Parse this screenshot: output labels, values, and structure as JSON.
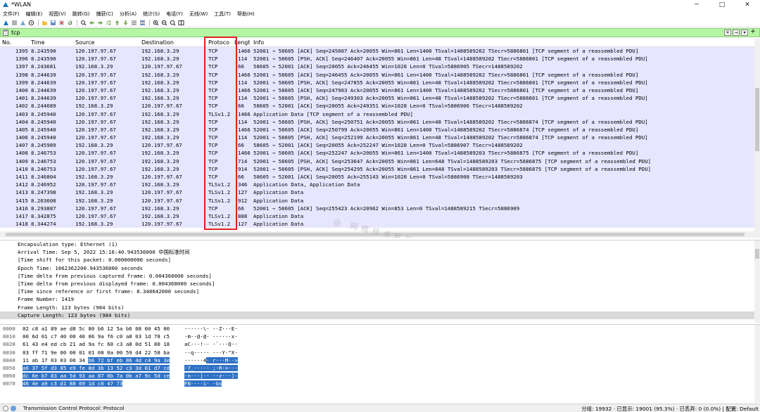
{
  "window": {
    "title": "*WLAN",
    "minimize": "─",
    "maximize": "□",
    "close": "✕"
  },
  "menu": [
    "文件(F)",
    "编辑(E)",
    "视图(V)",
    "跳转(G)",
    "捕获(C)",
    "分析(A)",
    "统计(S)",
    "电话(Y)",
    "无线(W)",
    "工具(T)",
    "帮助(H)"
  ],
  "filter": {
    "value": "tcp"
  },
  "columns": {
    "no": "No.",
    "time": "Time",
    "source": "Source",
    "destination": "Destination",
    "protocol": "Protoco",
    "length": "Lengt",
    "info": "Info"
  },
  "packets": [
    {
      "no": "1395",
      "time": "8.243590",
      "src": "120.197.97.67",
      "dst": "192.168.3.29",
      "proto": "TCP",
      "len": "1466",
      "info": "52001 → 58605 [ACK] Seq=245007 Ack=20055 Win=861 Len=1400 TSval=1488589202 TSecr=5886801 [TCP segment of a reassembled PDU]"
    },
    {
      "no": "1396",
      "time": "8.243590",
      "src": "120.197.97.67",
      "dst": "192.168.3.29",
      "proto": "TCP",
      "len": "114",
      "info": "52001 → 58605 [PSH, ACK] Seq=246407 Ack=20055 Win=861 Len=48 TSval=1488589202 TSecr=5886801 [TCP segment of a reassembled PDU]"
    },
    {
      "no": "1397",
      "time": "8.243681",
      "src": "192.168.3.29",
      "dst": "120.197.97.67",
      "proto": "TCP",
      "len": "66",
      "info": "58605 → 52001 [ACK] Seq=20055 Ack=246455 Win=1028 Len=0 TSval=5886905 TSecr=1488589202"
    },
    {
      "no": "1398",
      "time": "8.244639",
      "src": "120.197.97.67",
      "dst": "192.168.3.29",
      "proto": "TCP",
      "len": "1466",
      "info": "52001 → 58605 [ACK] Seq=246455 Ack=20055 Win=861 Len=1400 TSval=1488589202 TSecr=5886801 [TCP segment of a reassembled PDU]"
    },
    {
      "no": "1399",
      "time": "8.244639",
      "src": "120.197.97.67",
      "dst": "192.168.3.29",
      "proto": "TCP",
      "len": "114",
      "info": "52001 → 58605 [PSH, ACK] Seq=247855 Ack=20055 Win=861 Len=48 TSval=1488589202 TSecr=5886801 [TCP segment of a reassembled PDU]"
    },
    {
      "no": "1400",
      "time": "8.244639",
      "src": "120.197.97.67",
      "dst": "192.168.3.29",
      "proto": "TCP",
      "len": "1466",
      "info": "52001 → 58605 [ACK] Seq=247903 Ack=20055 Win=861 Len=1400 TSval=1488589202 TSecr=5886801 [TCP segment of a reassembled PDU]"
    },
    {
      "no": "1401",
      "time": "8.244639",
      "src": "120.197.97.67",
      "dst": "192.168.3.29",
      "proto": "TCP",
      "len": "114",
      "info": "52001 → 58605 [PSH, ACK] Seq=249303 Ack=20055 Win=861 Len=48 TSval=1488589202 TSecr=5886801 [TCP segment of a reassembled PDU]"
    },
    {
      "no": "1402",
      "time": "8.244689",
      "src": "192.168.3.29",
      "dst": "120.197.97.67",
      "proto": "TCP",
      "len": "66",
      "info": "58605 → 52001 [ACK] Seq=20055 Ack=249351 Win=1028 Len=0 TSval=5886906 TSecr=1488589202"
    },
    {
      "no": "1403",
      "time": "8.245940",
      "src": "120.197.97.67",
      "dst": "192.168.3.29",
      "proto": "TLSv1.2",
      "len": "1466",
      "info": "Application Data [TCP segment of a reassembled PDU]"
    },
    {
      "no": "1404",
      "time": "8.245940",
      "src": "120.197.97.67",
      "dst": "192.168.3.29",
      "proto": "TCP",
      "len": "114",
      "info": "52001 → 58605 [PSH, ACK] Seq=250751 Ack=20055 Win=861 Len=48 TSval=1488589202 TSecr=5886874 [TCP segment of a reassembled PDU]"
    },
    {
      "no": "1405",
      "time": "8.245940",
      "src": "120.197.97.67",
      "dst": "192.168.3.29",
      "proto": "TCP",
      "len": "1466",
      "info": "52001 → 58605 [ACK] Seq=250799 Ack=20055 Win=861 Len=1400 TSval=1488589202 TSecr=5886874 [TCP segment of a reassembled PDU]"
    },
    {
      "no": "1406",
      "time": "8.245940",
      "src": "120.197.97.67",
      "dst": "192.168.3.29",
      "proto": "TCP",
      "len": "114",
      "info": "52001 → 58605 [PSH, ACK] Seq=252199 Ack=20055 Win=861 Len=48 TSval=1488589202 TSecr=5886874 [TCP segment of a reassembled PDU]"
    },
    {
      "no": "1407",
      "time": "8.245989",
      "src": "192.168.3.29",
      "dst": "120.197.97.67",
      "proto": "TCP",
      "len": "66",
      "info": "58605 → 52001 [ACK] Seq=20055 Ack=252247 Win=1028 Len=0 TSval=5886907 TSecr=1488589202"
    },
    {
      "no": "1408",
      "time": "8.246753",
      "src": "120.197.97.67",
      "dst": "192.168.3.29",
      "proto": "TCP",
      "len": "1466",
      "info": "52001 → 58605 [ACK] Seq=252247 Ack=20055 Win=861 Len=1400 TSval=1488589203 TSecr=5886875 [TCP segment of a reassembled PDU]"
    },
    {
      "no": "1409",
      "time": "8.246753",
      "src": "120.197.97.67",
      "dst": "192.168.3.29",
      "proto": "TCP",
      "len": "714",
      "info": "52001 → 58605 [PSH, ACK] Seq=253647 Ack=20055 Win=861 Len=648 TSval=1488589203 TSecr=5886875 [TCP segment of a reassembled PDU]"
    },
    {
      "no": "1410",
      "time": "8.246753",
      "src": "120.197.97.67",
      "dst": "192.168.3.29",
      "proto": "TCP",
      "len": "914",
      "info": "52001 → 58605 [PSH, ACK] Seq=254295 Ack=20055 Win=861 Len=848 TSval=1488589203 TSecr=5886875 [TCP segment of a reassembled PDU]"
    },
    {
      "no": "1411",
      "time": "8.246804",
      "src": "192.168.3.29",
      "dst": "120.197.97.67",
      "proto": "TCP",
      "len": "66",
      "info": "58605 → 52001 [ACK] Seq=20055 Ack=255143 Win=1028 Len=0 TSval=5886908 TSecr=1488589203"
    },
    {
      "no": "1412",
      "time": "8.246952",
      "src": "120.197.97.67",
      "dst": "192.168.3.29",
      "proto": "TLSv1.2",
      "len": "346",
      "info": "Application Data, Application Data"
    },
    {
      "no": "1413",
      "time": "8.247398",
      "src": "192.168.3.29",
      "dst": "120.197.97.67",
      "proto": "TLSv1.2",
      "len": "127",
      "info": "Application Data"
    },
    {
      "no": "1415",
      "time": "8.263608",
      "src": "192.168.3.29",
      "dst": "120.197.97.67",
      "proto": "TLSv1.2",
      "len": "912",
      "info": "Application Data"
    },
    {
      "no": "1416",
      "time": "8.293887",
      "src": "120.197.97.67",
      "dst": "192.168.3.29",
      "proto": "TCP",
      "len": "66",
      "info": "52001 → 58605 [ACK] Seq=255423 Ack=20962 Win=853 Len=0 TSval=1488589215 TSecr=5886909"
    },
    {
      "no": "1417",
      "time": "8.342875",
      "src": "120.197.97.67",
      "dst": "192.168.3.29",
      "proto": "TLSv1.2",
      "len": "888",
      "info": "Application Data"
    },
    {
      "no": "1418",
      "time": "8.344274",
      "src": "192.168.3.29",
      "dst": "120.197.97.67",
      "proto": "TLSv1.2",
      "len": "127",
      "info": "Application Data"
    }
  ],
  "watermark": "@ 网络技术联盟站",
  "details": [
    "Encapsulation type: Ethernet (1)",
    "Arrival Time: Sep  5, 2022 15:16:40.943536000 中国标准时间",
    "[Time shift for this packet: 0.000000000 seconds]",
    "Epoch Time: 1662362200.943536000 seconds",
    "[Time delta from previous captured frame: 0.004368000 seconds]",
    "[Time delta from previous displayed frame: 0.004368000 seconds]",
    "[Time since reference or first frame: 8.348642000 seconds]",
    "Frame Number: 1419",
    "Frame Length: 123 bytes (984 bits)",
    "Capture Length: 123 bytes (984 bits)"
  ],
  "bytes": [
    {
      "off": "0000",
      "hex": "02 c8 a1 89 ae d8 5c 80  b6 12 5a b6 08 00 45 00",
      "hexhl": "",
      "asc": "······\\· ··Z···E·",
      "aschl": ""
    },
    {
      "off": "0010",
      "hex": "00 6d 01 c7 40 00 40 06  9a f6 c0 a8 03 1d 78 c5",
      "hexhl": "",
      "asc": "·m··@·@· ······x·",
      "aschl": ""
    },
    {
      "off": "0020",
      "hex": "61 43 e4 ed cb 21 ad 9a  fc 60 c3 a8 0d 51 80 18",
      "hexhl": "",
      "asc": "aC···!·· ·`···Q··",
      "aschl": ""
    },
    {
      "off": "0030",
      "hex": "03 ff 71 9e 00 00 01 01  08 0a 00 59 d4 22 58 ba",
      "hexhl": "",
      "asc": "··q····· ···Y·\"X·",
      "aschl": ""
    },
    {
      "off": "0040",
      "hex": "11 ab 17 03 03 00 34 ",
      "hexhl": "b6  72 bf eb 86 4d c4 9a 3e",
      "asc": "······4",
      "aschl": "· r···M··>"
    },
    {
      "off": "0050",
      "hex": "",
      "hexhl": "a6 37 5f d3 85 e9 fe 8d  3b 13 52 c3 3d 01 d7 cd",
      "asc": "",
      "aschl": "·7_····· ;·R·=···"
    },
    {
      "off": "0060",
      "hex": "",
      "hexhl": "dc 6e b7 83 aa 5d 93 aa  87 8b 7a 0b a7 9c 5d ce",
      "asc": "",
      "aschl": "·n···]·· ··z···]·"
    },
    {
      "off": "0070",
      "hex": "",
      "hexhl": "46 4e a9 c3 d1 88 69 1d  c0 47 73",
      "asc": "",
      "aschl": "FN····i· ·Gs"
    }
  ],
  "status": {
    "text": "Transmission Control Protocol: Protocol",
    "stats": "分组: 19932 · 已显示: 19001 (95.3%) · 已丢弃: 0 (0.0%) | 配置: Default"
  },
  "colors": {
    "filter_bg": "#b5f5a4",
    "row_bg": "#e7e6ff",
    "highlight_box": "#e02020",
    "byte_highlight": "#2f72c6"
  }
}
